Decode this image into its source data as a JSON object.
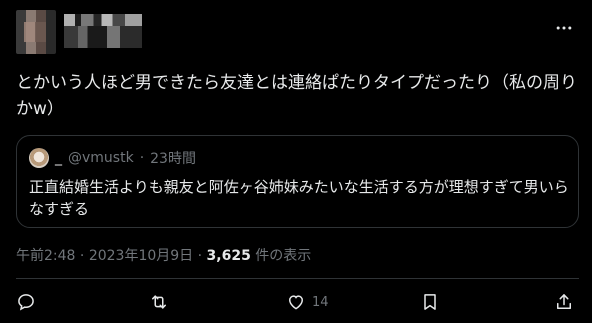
{
  "tweet": {
    "text_line1": "とかいう人ほど男できたら友達とは連絡ぱたりタイプだったり（私の周り",
    "text_line2": "かw）"
  },
  "quote": {
    "name": "_",
    "handle": "@vmustk",
    "separator": "·",
    "time": "23時間",
    "text_line1": "正直結婚生活よりも親友と阿佐ヶ谷姉妹みたいな生活する方が理想すぎて男いら",
    "text_line2": "なすぎる"
  },
  "meta": {
    "time": "午前2:48",
    "dot1": "·",
    "date": "2023年10月9日",
    "dot2": "·",
    "views": "3,625",
    "views_label": "件の表示"
  },
  "actions": {
    "like_count": "14"
  },
  "icons": {
    "more": "more-icon",
    "reply": "reply-icon",
    "retweet": "retweet-icon",
    "like": "heart-icon",
    "bookmark": "bookmark-icon",
    "share": "share-icon"
  },
  "colors": {
    "background": "#000000",
    "text": "#e7e9ea",
    "muted": "#71767b",
    "border": "#2f3336"
  }
}
